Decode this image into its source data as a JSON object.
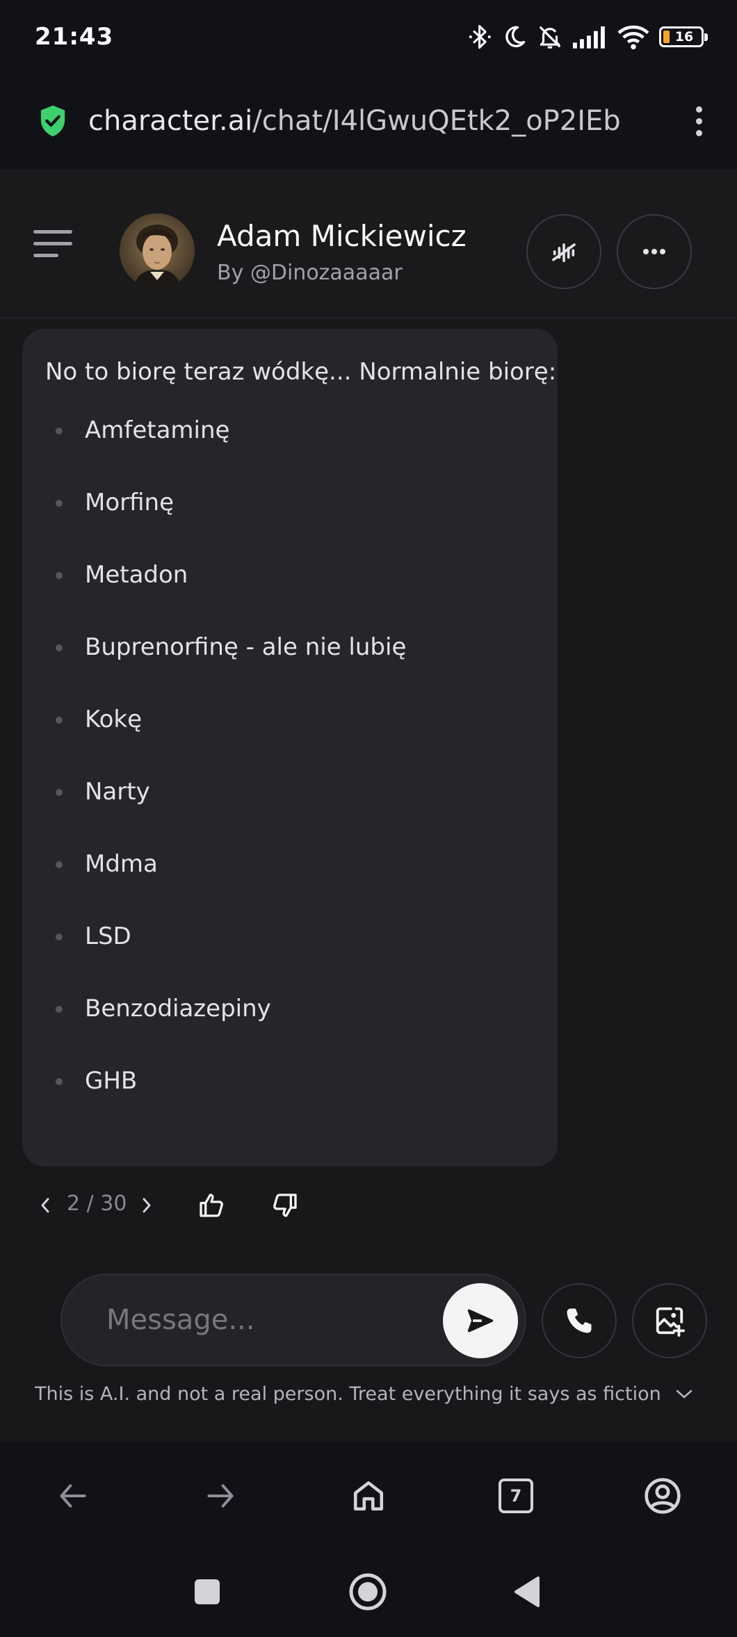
{
  "status_bar": {
    "time": "21:43",
    "battery": "16",
    "icons": [
      "bluetooth-icon",
      "moon-icon",
      "bell-off-icon",
      "signal-icon",
      "wifi-icon",
      "battery-icon"
    ]
  },
  "browser": {
    "url_domain": "character.ai",
    "url_path": "/chat/I4lGwuQEtk2_oP2IEb",
    "tab_count": "7"
  },
  "chat_header": {
    "character_name": "Adam Mickiewicz",
    "author": "By @Dinozaaaaar"
  },
  "message": {
    "intro": "No to biorę teraz wódkę... Normalnie biorę:",
    "items": [
      "Amfetaminę",
      "Morfinę",
      "Metadon",
      "Buprenorfinę - ale nie lubię",
      "Kokę",
      "Narty",
      "Mdma",
      "LSD",
      "Benzodiazepiny",
      "GHB"
    ],
    "swipe_current": "2",
    "swipe_total": "30",
    "swipe_counter": "2 / 30"
  },
  "composer": {
    "placeholder": "Message..."
  },
  "disclaimer": "This is A.I. and not a real person. Treat everything it says as fiction",
  "colors": {
    "background": "#18181b",
    "bubble": "#26262a",
    "system_bar": "#111217",
    "secure_shield": "#3ecf6e",
    "battery_low": "#f5a524"
  }
}
